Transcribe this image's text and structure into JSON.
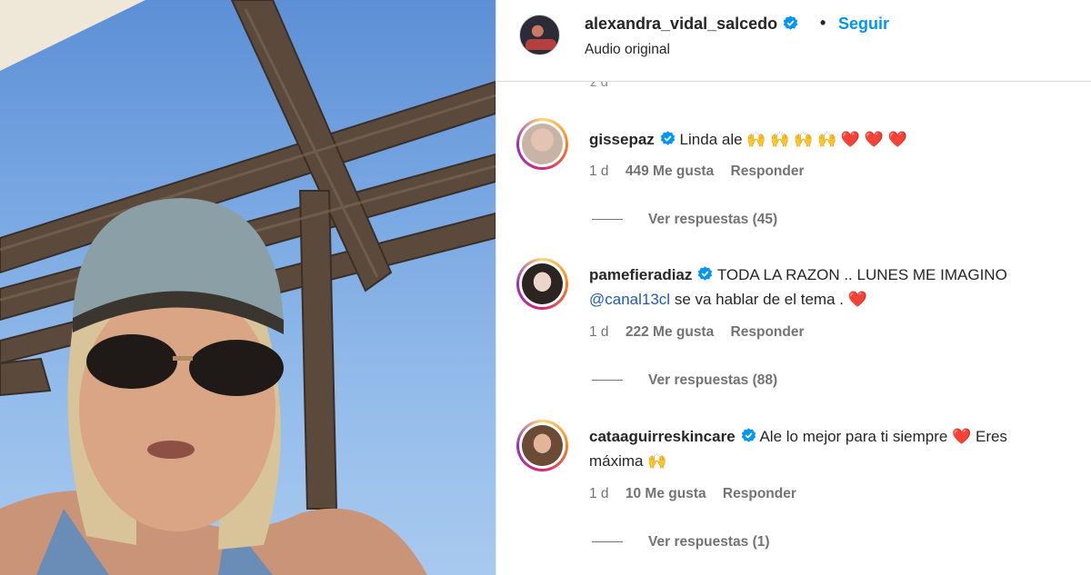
{
  "header": {
    "username": "alexandra_vidal_salcedo",
    "separator": "•",
    "follow_label": "Seguir",
    "audio_label": "Audio original"
  },
  "comments": [
    {
      "username": "gissepaz",
      "text": "Linda ale 🙌 🙌 🙌 🙌  ❤️ ❤️ ❤️",
      "text_prefix": "Linda ale",
      "time": "1 d",
      "likes": "449 Me gusta",
      "reply_label": "Responder",
      "view_replies": "Ver respuestas (45)"
    },
    {
      "username": "pamefieradiaz",
      "text_line1": "TODA LA RAZON .. LUNES ME IMAGINO",
      "mention": "@canal13cl",
      "text_line2": " se va hablar de el tema . ❤️",
      "time": "1 d",
      "likes": "222 Me gusta",
      "reply_label": "Responder",
      "view_replies": "Ver respuestas (88)"
    },
    {
      "username": "cataaguirreskincare",
      "text_line1": "Ale lo mejor para ti siempre ❤️ Eres",
      "text_line2": "máxima 🙌",
      "time": "1 d",
      "likes": "10 Me gusta",
      "reply_label": "Responder",
      "view_replies": "Ver respuestas (1)"
    }
  ],
  "icons": {
    "verified": "verified-badge-icon",
    "heart": "heart-emoji",
    "hands": "raised-hands-emoji"
  },
  "colors": {
    "accent": "#0095f6",
    "verified": "#0095f6",
    "mention": "#1e5bb8",
    "muted": "#737373"
  }
}
